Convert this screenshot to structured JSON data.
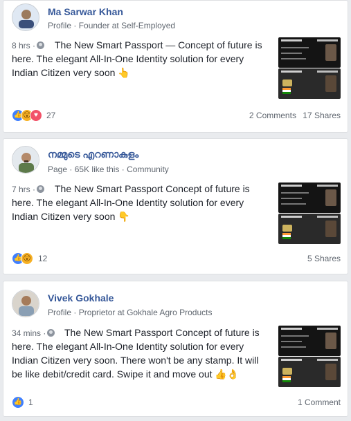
{
  "posts": [
    {
      "author": "Ma Sarwar Khan",
      "type": "Profile",
      "separator": "·",
      "subtitle": "Founder at Self-Employed",
      "time": "8 hrs",
      "dot": "·",
      "text": "The New Smart Passport — Concept of future is here. The elegant All-In-One Identity solution for every Indian Citizen very soon",
      "emoji": "👆",
      "reaction_count": "27",
      "comments": "2 Comments",
      "shares": "17 Shares",
      "reactions": [
        "like-icon",
        "wow-icon",
        "love-icon"
      ]
    },
    {
      "author": "നമ്മുടെ എറണാകുളം",
      "type": "Page",
      "separator": "·",
      "likes": "65K like this",
      "separator2": "·",
      "category": "Community",
      "time": "7 hrs",
      "dot": "·",
      "text": "The New Smart Passport Concept of future is here. The elegant All-In-One Identity solution for every Indian Citizen very soon",
      "emoji": "👇",
      "reaction_count": "12",
      "shares": "5 Shares",
      "reactions": [
        "like-icon",
        "wow-icon"
      ]
    },
    {
      "author": "Vivek Gokhale",
      "type": "Profile",
      "separator": "·",
      "subtitle": "Proprietor at Gokhale Agro Products",
      "time": "34 mins",
      "dot": "·",
      "text": "The New Smart Passport Concept of future is here. The elegant All-In-One Identity solution for every Indian Citizen very soon. There won't be any stamp. It will be like debit/credit card. Swipe it and move out",
      "emoji": "👍👌",
      "reaction_count": "1",
      "comments": "1 Comment",
      "reactions": [
        "like-icon"
      ]
    }
  ],
  "colors": {
    "author": "#365899",
    "meta": "#606770",
    "like": "#4080ff",
    "wow": "#f7b125",
    "love": "#f25268"
  }
}
